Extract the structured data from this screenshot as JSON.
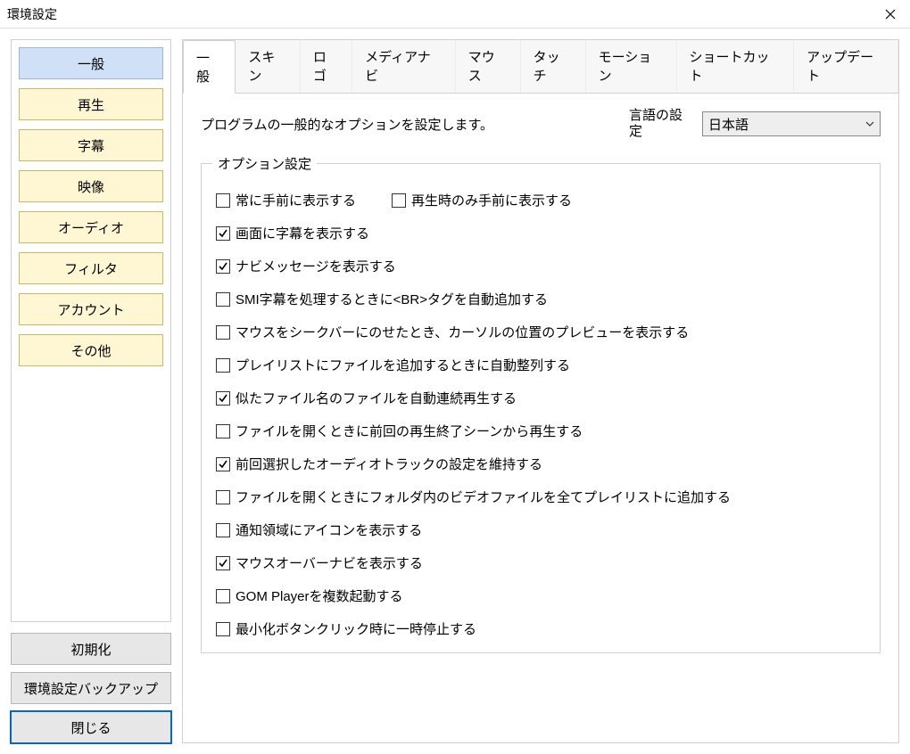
{
  "window": {
    "title": "環境設定"
  },
  "sidebar": {
    "items": [
      {
        "label": "一般",
        "active": true
      },
      {
        "label": "再生",
        "active": false
      },
      {
        "label": "字幕",
        "active": false
      },
      {
        "label": "映像",
        "active": false
      },
      {
        "label": "オーディオ",
        "active": false
      },
      {
        "label": "フィルタ",
        "active": false
      },
      {
        "label": "アカウント",
        "active": false
      },
      {
        "label": "その他",
        "active": false
      }
    ],
    "buttons": {
      "reset": "初期化",
      "backup": "環境設定バックアップ",
      "close": "閉じる"
    }
  },
  "tabs": [
    {
      "label": "一般",
      "active": true
    },
    {
      "label": "スキン",
      "active": false
    },
    {
      "label": "ロゴ",
      "active": false
    },
    {
      "label": "メディアナビ",
      "active": false
    },
    {
      "label": "マウス",
      "active": false
    },
    {
      "label": "タッチ",
      "active": false
    },
    {
      "label": "モーション",
      "active": false
    },
    {
      "label": "ショートカット",
      "active": false
    },
    {
      "label": "アップデート",
      "active": false
    }
  ],
  "content": {
    "description": "プログラムの一般的なオプションを設定します。",
    "language_label": "言語の設定",
    "language_value": "日本語",
    "fieldset_title": "オプション設定",
    "options": [
      {
        "label": "常に手前に表示する",
        "checked": false,
        "row": 0
      },
      {
        "label": "再生時のみ手前に表示する",
        "checked": false,
        "row": 0
      },
      {
        "label": "画面に字幕を表示する",
        "checked": true
      },
      {
        "label": "ナビメッセージを表示する",
        "checked": true
      },
      {
        "label": "SMI字幕を処理するときに<BR>タグを自動追加する",
        "checked": false
      },
      {
        "label": "マウスをシークバーにのせたとき、カーソルの位置のプレビューを表示する",
        "checked": false
      },
      {
        "label": "プレイリストにファイルを追加するときに自動整列する",
        "checked": false
      },
      {
        "label": "似たファイル名のファイルを自動連続再生する",
        "checked": true
      },
      {
        "label": "ファイルを開くときに前回の再生終了シーンから再生する",
        "checked": false
      },
      {
        "label": "前回選択したオーディオトラックの設定を維持する",
        "checked": true
      },
      {
        "label": "ファイルを開くときにフォルダ内のビデオファイルを全てプレイリストに追加する",
        "checked": false
      },
      {
        "label": "通知領域にアイコンを表示する",
        "checked": false
      },
      {
        "label": "マウスオーバーナビを表示する",
        "checked": true
      },
      {
        "label": "GOM Playerを複数起動する",
        "checked": false
      },
      {
        "label": "最小化ボタンクリック時に一時停止する",
        "checked": false
      }
    ]
  }
}
